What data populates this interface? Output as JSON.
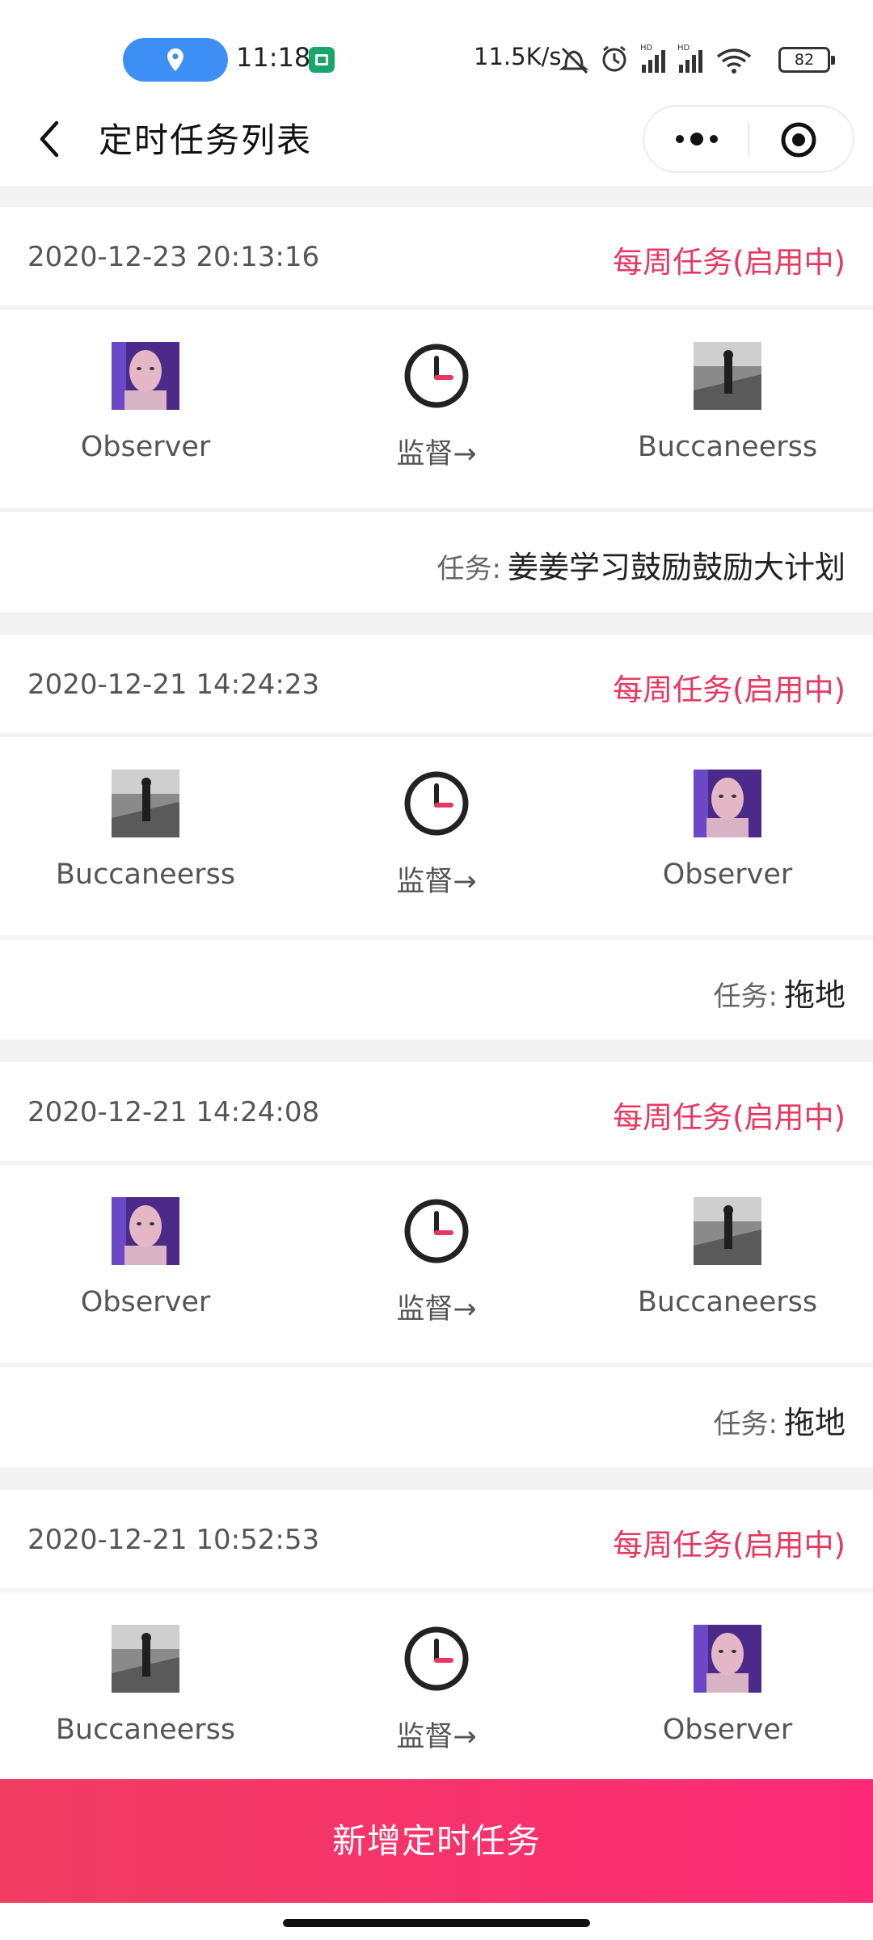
{
  "status_bar": {
    "time": "11:18",
    "net_speed": "11.5K/s",
    "battery": "82",
    "icons": [
      "location-icon",
      "app-icon",
      "mute-icon",
      "alarm-icon",
      "signal-icon",
      "signal-icon",
      "wifi-icon"
    ]
  },
  "nav": {
    "title": "定时任务列表"
  },
  "tasks": [
    {
      "time": "2020-12-23 20:13:16",
      "badge": "每周任务(启用中)",
      "from_user": "Observer",
      "verb": "监督→",
      "to_user": "Buccaneerss",
      "task_label": "任务:",
      "task_name": "姜姜学习鼓励鼓励大计划"
    },
    {
      "time": "2020-12-21 14:24:23",
      "badge": "每周任务(启用中)",
      "from_user": "Buccaneerss",
      "verb": "监督→",
      "to_user": "Observer",
      "task_label": "任务:",
      "task_name": "拖地"
    },
    {
      "time": "2020-12-21 14:24:08",
      "badge": "每周任务(启用中)",
      "from_user": "Observer",
      "verb": "监督→",
      "to_user": "Buccaneerss",
      "task_label": "任务:",
      "task_name": "拖地"
    },
    {
      "time": "2020-12-21 10:52:53",
      "badge": "每周任务(启用中)",
      "from_user": "Buccaneerss",
      "verb": "监督→",
      "to_user": "Observer",
      "task_label": "任务:",
      "task_name": ""
    }
  ],
  "add_button": "新增定时任务",
  "colors": {
    "accent": "#e8375f",
    "button_start": "#f03c61",
    "button_end": "#fc2a76"
  }
}
